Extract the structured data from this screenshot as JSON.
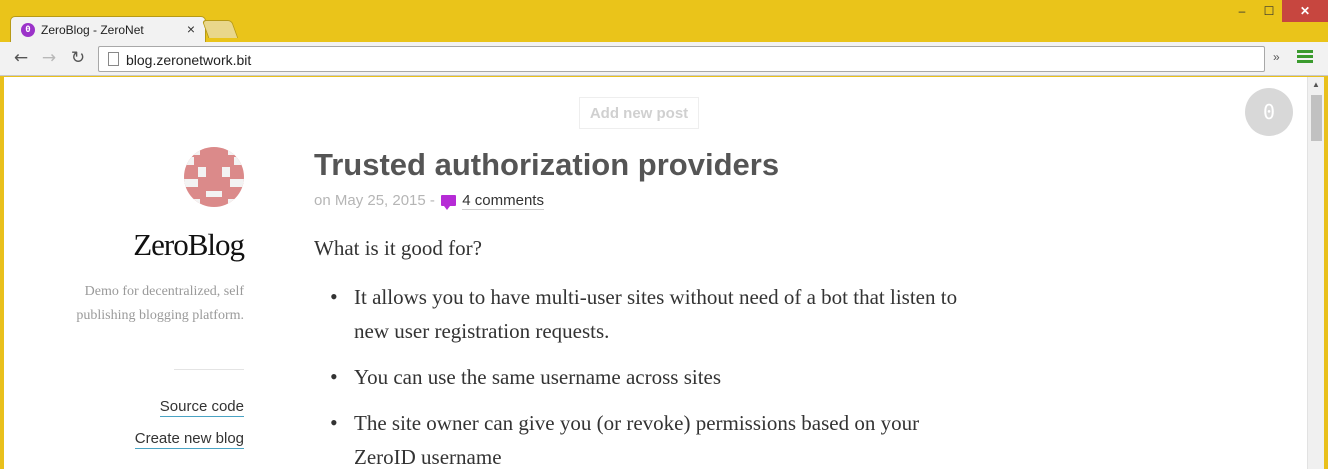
{
  "browser": {
    "tab_title": "ZeroBlog - ZeroNet",
    "tab_favicon": "0",
    "url": "blog.zeronetwork.bit"
  },
  "page": {
    "add_post_label": "Add new post",
    "badge": "0",
    "sidebar": {
      "title": "ZeroBlog",
      "description": "Demo for decentralized, self publishing blogging platform.",
      "links": [
        "Source code",
        "Create new blog"
      ]
    },
    "post": {
      "title": "Trusted authorization providers",
      "date": "on May 25, 2015 -",
      "comments": "4 comments",
      "intro": "What is it good for?",
      "bullets": [
        "It allows you to have multi-user sites without need of a bot that listen to new user registration requests.",
        "You can use the same username across sites",
        "The site owner can give you (or revoke) permissions based on your ZeroID username"
      ]
    }
  },
  "colors": {
    "window_frame": "#eac41a",
    "accent_purple": "#b62bd6",
    "link_underline": "#4aa3c4"
  }
}
